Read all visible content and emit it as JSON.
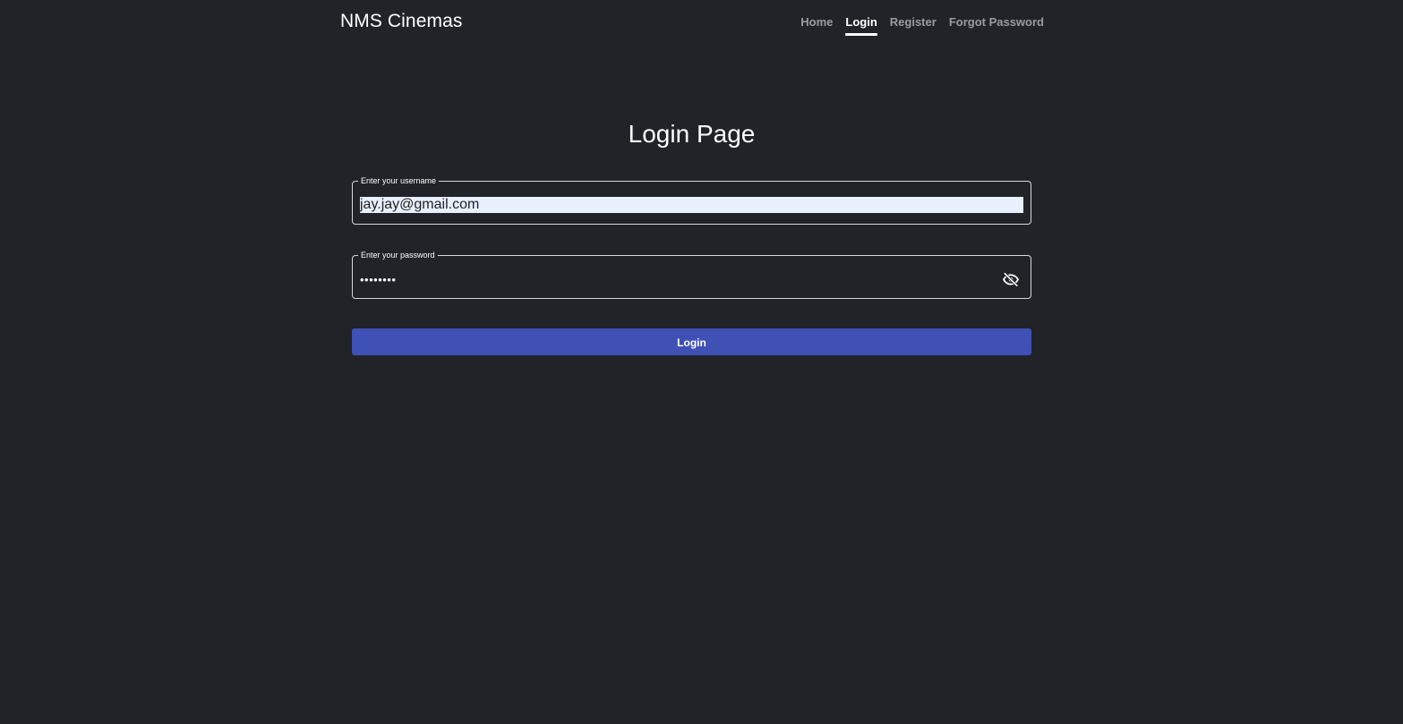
{
  "header": {
    "brand": "NMS Cinemas",
    "nav": [
      {
        "label": "Home",
        "active": false
      },
      {
        "label": "Login",
        "active": true
      },
      {
        "label": "Register",
        "active": false
      },
      {
        "label": "Forgot Password",
        "active": false
      }
    ]
  },
  "main": {
    "title": "Login Page",
    "username": {
      "label": "Enter your username",
      "value": "jay.jay@gmail.com"
    },
    "password": {
      "label": "Enter your password",
      "value": "••••••••",
      "toggle_icon": "eye-off-icon"
    },
    "login_button": "Login"
  },
  "colors": {
    "background": "#212329",
    "primary": "#3f51b5",
    "autofill": "#e8f0fe"
  }
}
